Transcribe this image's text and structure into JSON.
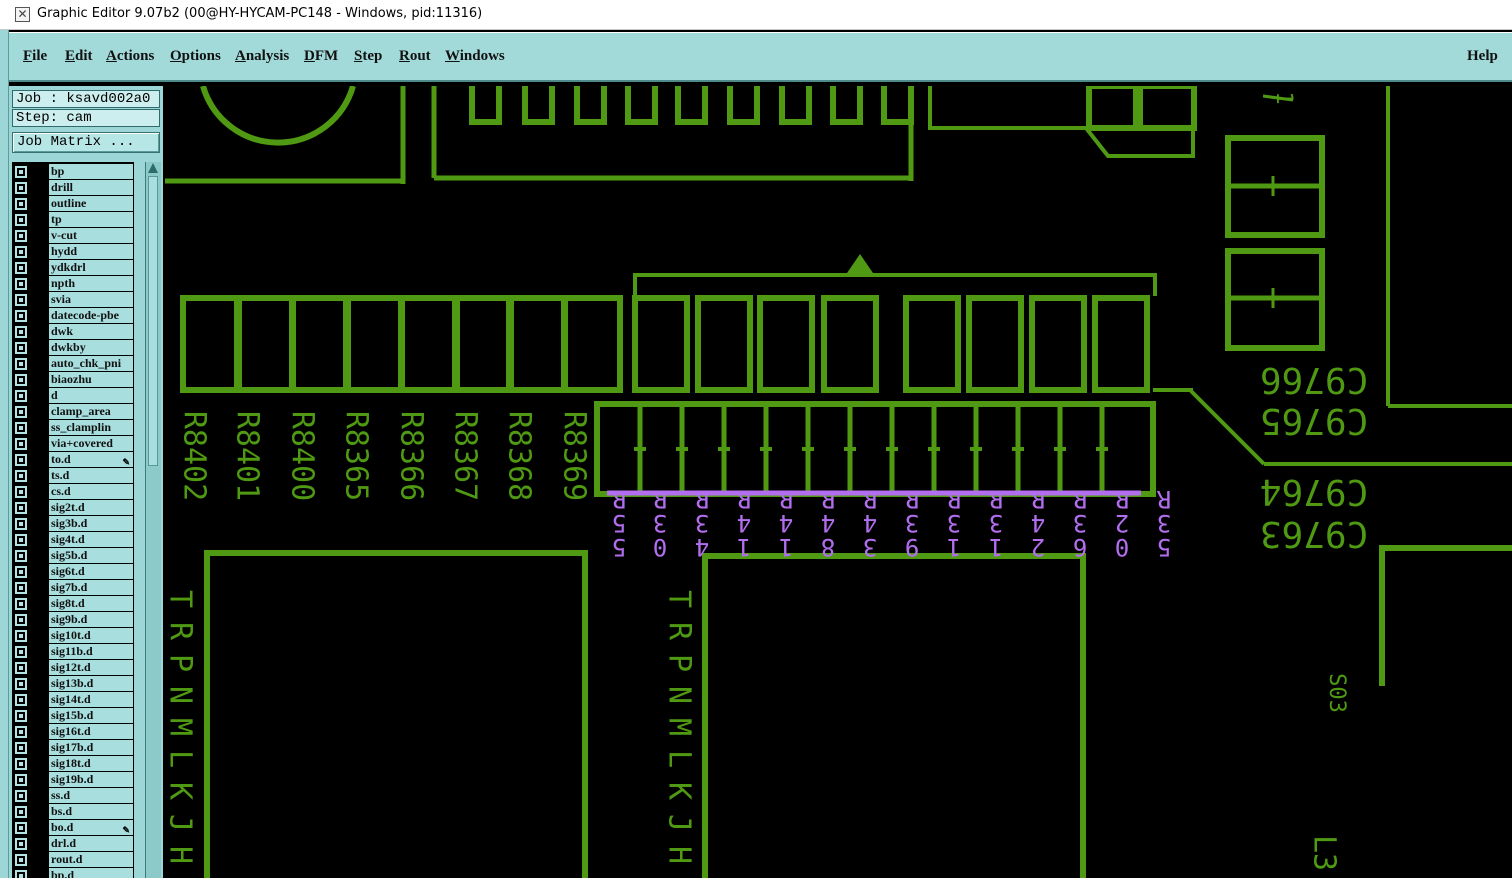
{
  "window": {
    "title": "Graphic Editor 9.07b2 (00@HY-HYCAM-PC148 - Windows, pid:11316)",
    "icon": "x-app-icon"
  },
  "menubar": {
    "file": "File",
    "edit": "Edit",
    "actions": "Actions",
    "options": "Options",
    "analysis": "Analysis",
    "dfm": "DFM",
    "step": "Step",
    "rout": "Rout",
    "windows": "Windows",
    "help": "Help"
  },
  "panel": {
    "job": "Job : ksavd002a0",
    "step": "Step: cam",
    "job_matrix": "Job Matrix ..."
  },
  "layers": [
    {
      "name": "bp"
    },
    {
      "name": "drill"
    },
    {
      "name": "outline"
    },
    {
      "name": "tp"
    },
    {
      "name": "v-cut"
    },
    {
      "name": "hydd"
    },
    {
      "name": "ydkdrl"
    },
    {
      "name": "npth"
    },
    {
      "name": "svia"
    },
    {
      "name": "datecode-pbe"
    },
    {
      "name": "dwk"
    },
    {
      "name": "dwkby"
    },
    {
      "name": "auto_chk_pni"
    },
    {
      "name": "biaozhu"
    },
    {
      "name": "d"
    },
    {
      "name": "clamp_area"
    },
    {
      "name": "ss_clamplin"
    },
    {
      "name": "via+covered"
    },
    {
      "name": "to.d",
      "arrow": true
    },
    {
      "name": "ts.d"
    },
    {
      "name": "cs.d"
    },
    {
      "name": "sig2t.d"
    },
    {
      "name": "sig3b.d"
    },
    {
      "name": "sig4t.d"
    },
    {
      "name": "sig5b.d"
    },
    {
      "name": "sig6t.d"
    },
    {
      "name": "sig7b.d"
    },
    {
      "name": "sig8t.d"
    },
    {
      "name": "sig9b.d"
    },
    {
      "name": "sig10t.d"
    },
    {
      "name": "sig11b.d"
    },
    {
      "name": "sig12t.d"
    },
    {
      "name": "sig13b.d"
    },
    {
      "name": "sig14t.d"
    },
    {
      "name": "sig15b.d"
    },
    {
      "name": "sig16t.d"
    },
    {
      "name": "sig17b.d"
    },
    {
      "name": "sig18t.d"
    },
    {
      "name": "sig19b.d"
    },
    {
      "name": "ss.d"
    },
    {
      "name": "bs.d"
    },
    {
      "name": "bo.d",
      "arrow": true
    },
    {
      "name": "drl.d"
    },
    {
      "name": "rout.d"
    },
    {
      "name": "bp.d"
    }
  ],
  "board": {
    "colors": {
      "primary": "#4f9a12",
      "highlight": "#b36ef0",
      "background": "#000000"
    },
    "res_labels": [
      "R8402",
      "R8401",
      "R8400",
      "R8365",
      "R8366",
      "R8367",
      "R8368",
      "R8369"
    ],
    "cap_labels": [
      "C9766",
      "C9765",
      "C9764",
      "C9763"
    ],
    "sel_row1": [
      "R",
      "R",
      "R",
      "R",
      "R",
      "R",
      "R",
      "R",
      "R",
      "R",
      "R",
      "R",
      "R",
      "R"
    ],
    "sel_row2": [
      "5",
      "3",
      "3",
      "4",
      "4",
      "4",
      "4",
      "3",
      "3",
      "3",
      "4",
      "3",
      "2",
      "3"
    ],
    "sel_row3": [
      "5",
      "0",
      "4",
      "1",
      "1",
      "8",
      "3",
      "9",
      "1",
      "1",
      "2",
      "6",
      "0",
      "5"
    ],
    "left_col_letters": [
      "T",
      "R",
      "P",
      "N",
      "M",
      "L",
      "K",
      "J",
      "H"
    ],
    "mid_col_letters": [
      "T",
      "R",
      "P",
      "N",
      "M",
      "L",
      "K",
      "J",
      "H"
    ],
    "misc_labels": {
      "top_mark": "1",
      "side_mark": "S03",
      "bottom_mark": "L3"
    }
  }
}
